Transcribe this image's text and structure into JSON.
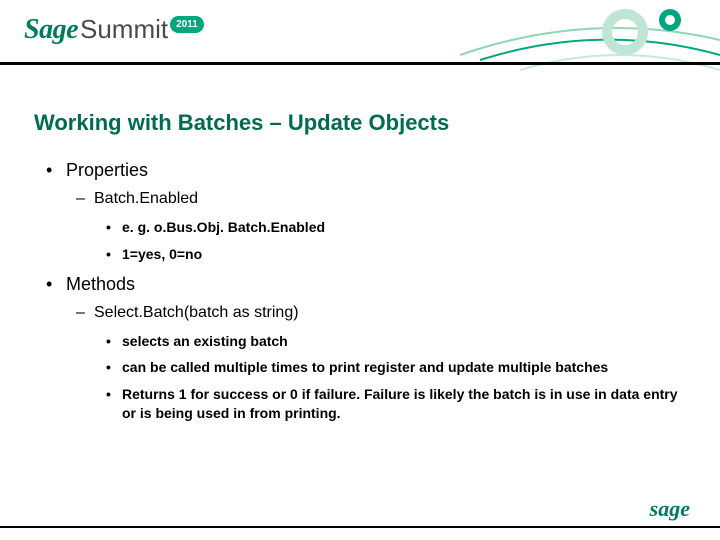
{
  "header": {
    "brand": "Sage",
    "event": "Summit",
    "year": "2011"
  },
  "title": "Working with Batches – Update Objects",
  "body": {
    "l1": [
      {
        "text": "Properties",
        "l2": [
          {
            "text": "Batch.Enabled",
            "l3": [
              "e. g. o.Bus.Obj. Batch.Enabled",
              "1=yes, 0=no"
            ]
          }
        ]
      },
      {
        "text": "Methods",
        "l2": [
          {
            "text": "Select.Batch(batch as string)",
            "l3": [
              "selects an existing batch",
              "can be called multiple times to print register and update multiple batches",
              "Returns 1 for success or  0 if failure.  Failure is likely the batch is in use in data entry or is being used in from printing."
            ]
          }
        ]
      }
    ]
  },
  "footer": {
    "brand": "sage"
  }
}
